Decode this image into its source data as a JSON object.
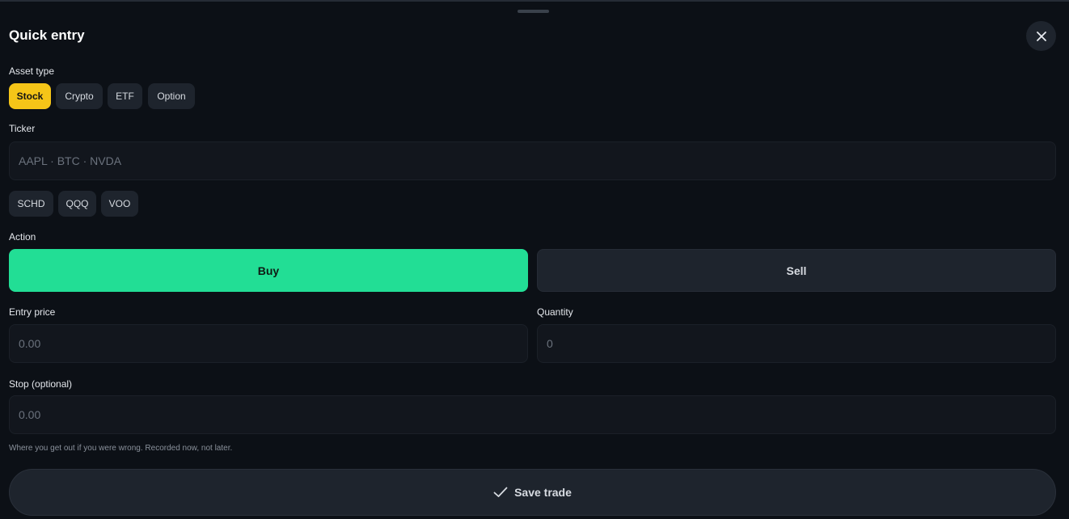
{
  "dialog": {
    "title": "Quick entry"
  },
  "asset_type": {
    "label": "Asset type",
    "options": [
      "Stock",
      "Crypto",
      "ETF",
      "Option"
    ],
    "selected": "Stock"
  },
  "ticker": {
    "label": "Ticker",
    "placeholder": "AAPL · BTC · NVDA",
    "value": "",
    "suggestions": [
      "SCHD",
      "QQQ",
      "VOO"
    ]
  },
  "action": {
    "label": "Action",
    "buy_label": "Buy",
    "sell_label": "Sell",
    "selected": "Buy"
  },
  "entry_price": {
    "label": "Entry price",
    "placeholder": "0.00",
    "value": ""
  },
  "quantity": {
    "label": "Quantity",
    "placeholder": "0",
    "value": ""
  },
  "stop": {
    "label": "Stop (optional)",
    "placeholder": "0.00",
    "value": "",
    "hint": "Where you get out if you were wrong. Recorded now, not later."
  },
  "save": {
    "label": "Save trade"
  },
  "icons": {
    "close": "close-icon",
    "save": "checkmark-icon"
  },
  "colors": {
    "background": "#0c1016",
    "accent_selected": "#f5c518",
    "buy": "#22de95",
    "chip": "#1e242d"
  }
}
